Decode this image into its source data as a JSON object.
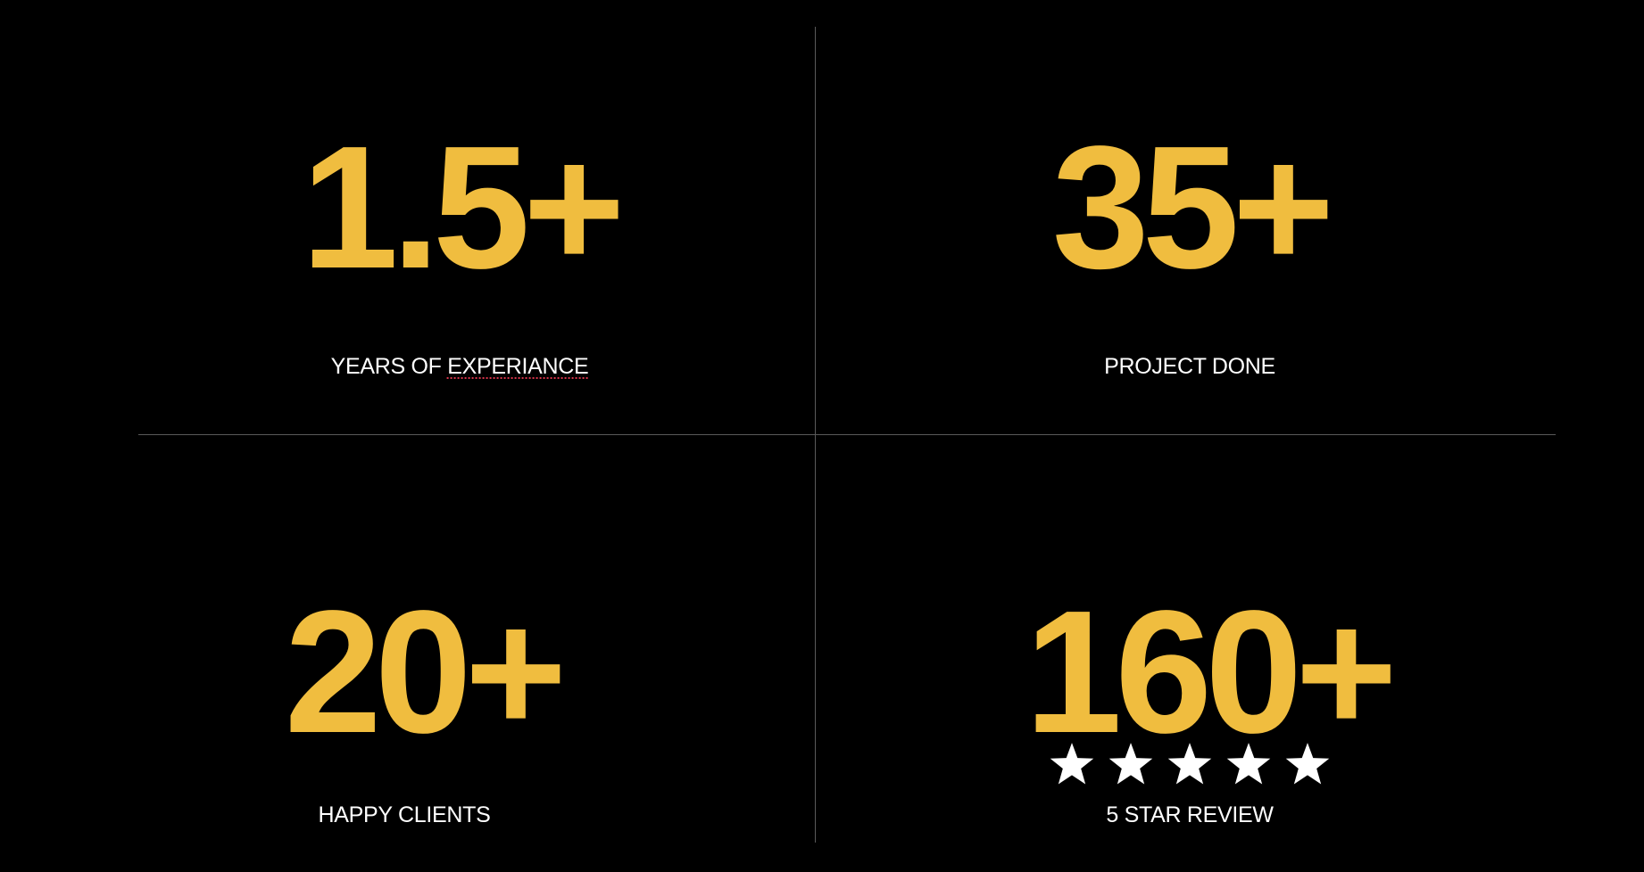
{
  "stats": [
    {
      "value": "1.5+",
      "label_lead": "YEARS OF ",
      "label_flagged": "EXPERIANCE"
    },
    {
      "value": "35+",
      "label": "PROJECT DONE"
    },
    {
      "value": "20+",
      "label": "HAPPY CLIENTS"
    },
    {
      "value": "160+",
      "label": "5 STAR REVIEW",
      "rating": 5
    }
  ],
  "colors": {
    "background": "#000000",
    "accent": "#F0BD3F",
    "label": "#ffffff",
    "divider": "#5a5a5a"
  },
  "icons": {
    "rating_star": "star-icon"
  }
}
